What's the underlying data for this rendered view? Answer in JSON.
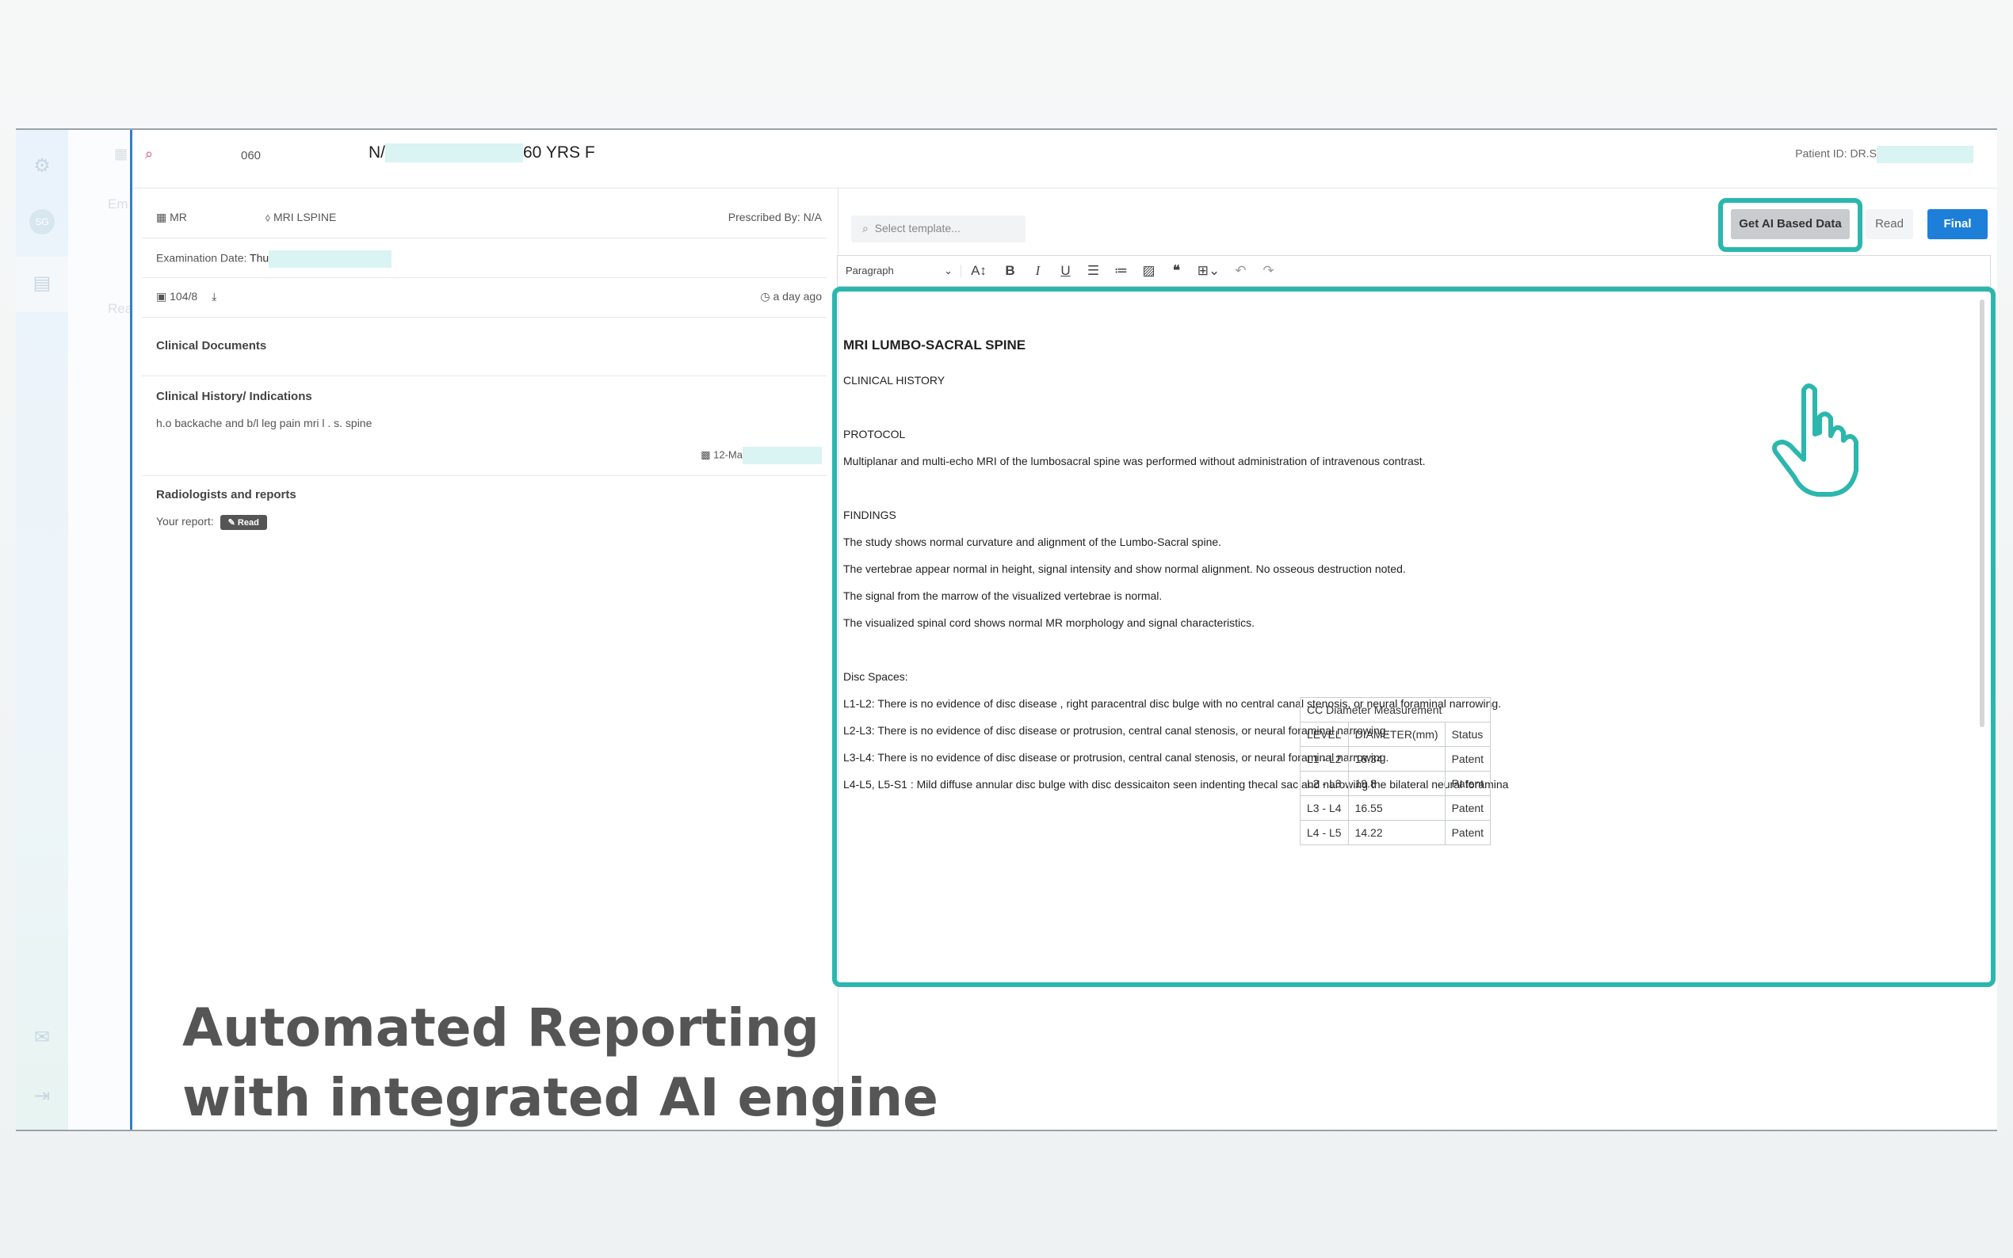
{
  "header": {
    "code": "060",
    "name_prefix": "N/",
    "age_sex": "60 YRS F",
    "patient_id": "Patient ID: DR.S"
  },
  "sidebar": {
    "avatar": "SG",
    "ghost_tab": "Em",
    "ghost_sub": "Rea"
  },
  "study": {
    "modality": "MR",
    "study_name": "MRI LSPINE",
    "prescribed_by": "Prescribed By: N/A",
    "exam_date_label": "Examination Date:",
    "exam_date_value": "Thu",
    "images": "104/8",
    "time_ago": "a day ago",
    "clinical_documents": "Clinical Documents",
    "clinical_history_title": "Clinical History/ Indications",
    "clinical_history_text": "h.o backache and b/l leg pain mri l . s. spine",
    "note_date": "12-Ma",
    "radiologists_title": "Radiologists and reports",
    "your_report": "Your report:",
    "read_badge": "Read"
  },
  "overlay": {
    "line1": "Automated Reporting",
    "line2": "with integrated AI engine"
  },
  "editor_controls": {
    "template_placeholder": "Select template...",
    "get_ai": "Get AI Based Data",
    "read": "Read",
    "final": "Final",
    "paragraph": "Paragraph"
  },
  "report": {
    "title": "MRI LUMBO-SACRAL SPINE",
    "clinical_history": "CLINICAL HISTORY",
    "protocol": "PROTOCOL",
    "protocol_text": "Multiplanar and multi-echo MRI of the lumbosacral spine was performed without administration of intravenous contrast.",
    "findings": "FINDINGS",
    "f1": "The study shows normal curvature and alignment of the Lumbo-Sacral spine.",
    "f2": "The vertebrae appear normal in height, signal intensity and show normal alignment. No osseous destruction noted.",
    "f3": "The signal from the marrow of the visualized vertebrae is normal.",
    "f4": "The visualized spinal cord shows normal MR morphology and signal characteristics.",
    "disc_spaces": "Disc Spaces:",
    "d1": "L1-L2: There is no evidence of disc disease , right paracentral disc bulge with no central canal stenosis, or neural foraminal narrowing.",
    "d2": "L2-L3: There is no evidence of disc disease or protrusion, central canal stenosis, or neural foraminal narrowing.",
    "d3": "L3-L4: There is no evidence of disc disease or protrusion, central canal stenosis, or neural foraminal narrowing.",
    "d4": "L4-L5, L5-S1 : Mild diffuse annular disc bulge with disc dessicaiton seen indenting thecal sac and narowing the bilateral neural foramina"
  },
  "table": {
    "caption": "CC Diameter Measurement",
    "headers": [
      "LEVEL",
      "DIAMETER(mm)",
      "Status"
    ],
    "rows": [
      [
        "L1 - L2",
        "18.34",
        "Patent"
      ],
      [
        "L2 - L3",
        "19.8",
        "Patent"
      ],
      [
        "L3 - L4",
        "16.55",
        "Patent"
      ],
      [
        "L4 - L5",
        "14.22",
        "Patent"
      ]
    ]
  },
  "colors": {
    "accent": "#2bb7ad",
    "primary": "#1e7fd8",
    "highlight": "#e0407a"
  }
}
